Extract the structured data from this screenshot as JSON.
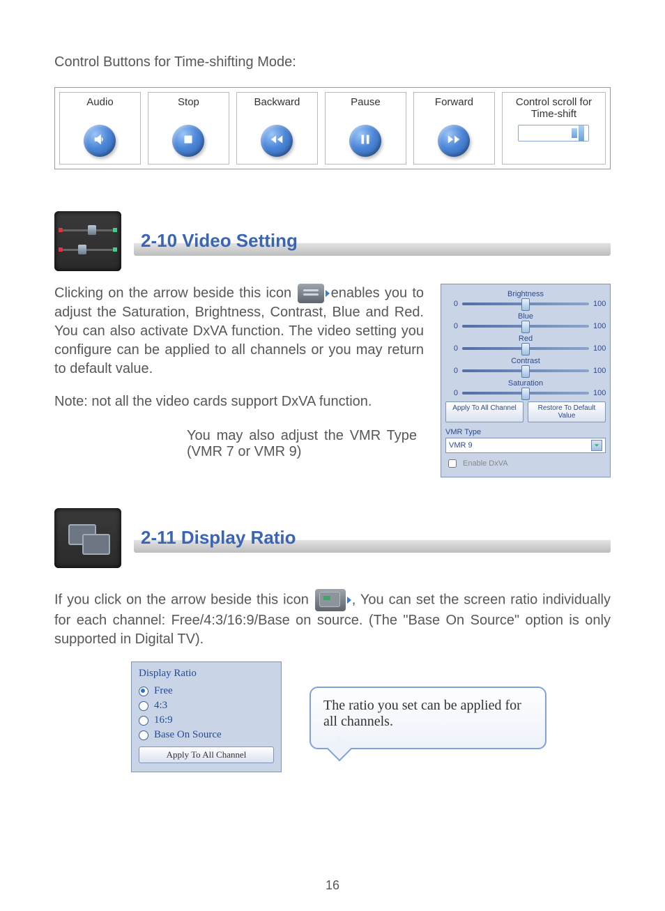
{
  "intro": "Control Buttons for Time-shifting Mode:",
  "controls": {
    "audio": "Audio",
    "stop": "Stop",
    "backward": "Backward",
    "pause": "Pause",
    "forward": "Forward",
    "scroll": "Control scroll for Time-shift"
  },
  "section_video": {
    "title": "2-10 Video Setting",
    "p1a": "Clicking on the arrow beside this icon ",
    "p1b": " enables you to adjust the Saturation, Brightness, Contrast, Blue and Red. You can also activate DxVA function. The video setting you configure can be applied to all channels or you may return to default value.",
    "note": "Note: not all the video cards support DxVA function.",
    "vmr": "You may also adjust the VMR Type (VMR 7 or VMR 9)"
  },
  "panel": {
    "sliders": [
      {
        "label": "Brightness",
        "min": "0",
        "max": "100"
      },
      {
        "label": "Blue",
        "min": "0",
        "max": "100"
      },
      {
        "label": "Red",
        "min": "0",
        "max": "100"
      },
      {
        "label": "Contrast",
        "min": "0",
        "max": "100"
      },
      {
        "label": "Saturation",
        "min": "0",
        "max": "100"
      }
    ],
    "apply": "Apply To All Channel",
    "restore": "Restore To Default Value",
    "vmr_type_label": "VMR Type",
    "vmr_selected": "VMR 9",
    "enable_dxva": "Enable DxVA"
  },
  "section_display": {
    "title": "2-11 Display Ratio",
    "p1a": "If you click on the arrow beside this icon ",
    "p1b": " , You can set the screen ratio individually for each channel: Free/4:3/16:9/Base on source. (The \"Base On Source\" option is only supported in Digital TV)."
  },
  "ratio_box": {
    "title": "Display Ratio",
    "options": {
      "free": "Free",
      "r43": "4:3",
      "r169": "16:9",
      "base": "Base On Source"
    },
    "apply": "Apply To All Channel"
  },
  "callout": "The ratio you set can be applied for all channels.",
  "page_number": "16"
}
